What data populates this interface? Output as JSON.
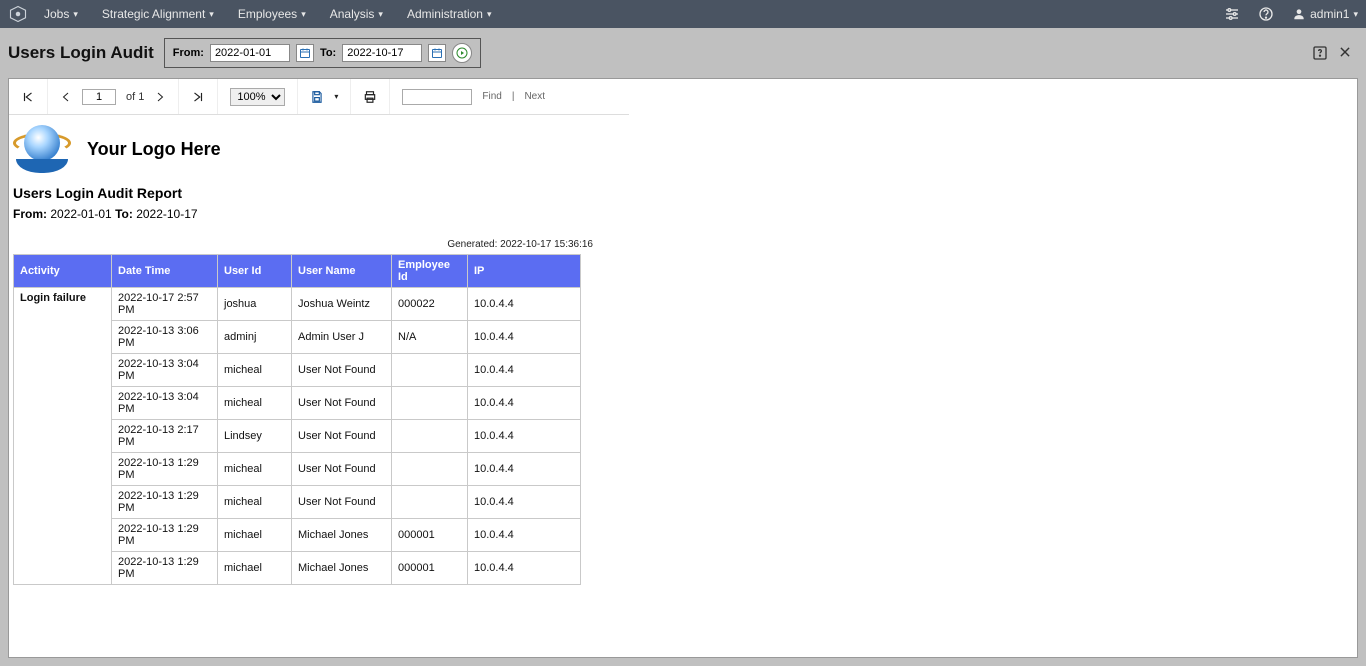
{
  "nav": {
    "items": [
      "Jobs",
      "Strategic Alignment",
      "Employees",
      "Analysis",
      "Administration"
    ],
    "user": "admin1"
  },
  "filter": {
    "page_title": "Users Login Audit",
    "from_label": "From:",
    "from_value": "2022-01-01",
    "to_label": "To:",
    "to_value": "2022-10-17"
  },
  "rpt_toolbar": {
    "page_value": "1",
    "of_text": "of 1",
    "zoom_value": "100%",
    "find_label": "Find",
    "next_label": "Next"
  },
  "report": {
    "logo_text": "Your Logo Here",
    "title": "Users Login Audit Report",
    "from_label": "From:",
    "from_value": "2022-01-01",
    "to_label": "To:",
    "to_value": "2022-10-17",
    "generated": "Generated: 2022-10-17 15:36:16"
  },
  "table": {
    "columns": [
      "Activity",
      "Date Time",
      "User Id",
      "User Name",
      "Employee Id",
      "IP"
    ],
    "activity": "Login failure",
    "rows": [
      {
        "datetime": "2022-10-17 2:57 PM",
        "userid": "joshua",
        "username": "Joshua Weintz",
        "empid": "000022",
        "ip": "10.0.4.4"
      },
      {
        "datetime": "2022-10-13 3:06 PM",
        "userid": "adminj",
        "username": "Admin User J",
        "empid": "N/A",
        "ip": "10.0.4.4"
      },
      {
        "datetime": "2022-10-13 3:04 PM",
        "userid": "micheal",
        "username": "User Not Found",
        "empid": "",
        "ip": "10.0.4.4"
      },
      {
        "datetime": "2022-10-13 3:04 PM",
        "userid": "micheal",
        "username": "User Not Found",
        "empid": "",
        "ip": "10.0.4.4"
      },
      {
        "datetime": "2022-10-13 2:17 PM",
        "userid": "Lindsey",
        "username": "User Not Found",
        "empid": "",
        "ip": "10.0.4.4"
      },
      {
        "datetime": "2022-10-13 1:29 PM",
        "userid": "micheal",
        "username": "User Not Found",
        "empid": "",
        "ip": "10.0.4.4"
      },
      {
        "datetime": "2022-10-13 1:29 PM",
        "userid": "micheal",
        "username": "User Not Found",
        "empid": "",
        "ip": "10.0.4.4"
      },
      {
        "datetime": "2022-10-13 1:29 PM",
        "userid": "michael",
        "username": "Michael Jones",
        "empid": "000001",
        "ip": "10.0.4.4"
      },
      {
        "datetime": "2022-10-13 1:29 PM",
        "userid": "michael",
        "username": "Michael Jones",
        "empid": "000001",
        "ip": "10.0.4.4"
      }
    ]
  }
}
